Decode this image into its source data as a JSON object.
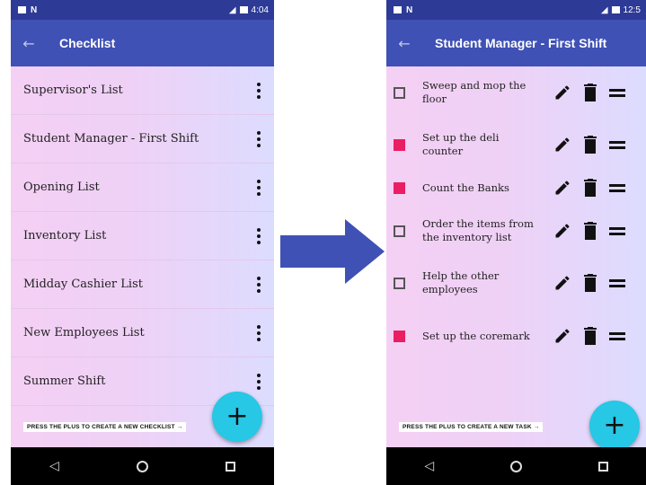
{
  "left_screen": {
    "status_time": "4:04",
    "title": "Checklist",
    "back_icon": "back-arrow-icon",
    "checklists": [
      {
        "label": "Supervisor's List"
      },
      {
        "label": "Student Manager - First Shift"
      },
      {
        "label": "Opening List"
      },
      {
        "label": "Inventory List"
      },
      {
        "label": "Midday Cashier List"
      },
      {
        "label": "New Employees List"
      },
      {
        "label": "Summer Shift"
      }
    ],
    "hint": "PRESS THE PLUS TO CREATE A NEW CHECKLIST →",
    "fab_label": "+"
  },
  "right_screen": {
    "status_time": "12:5",
    "title": "Student Manager - First Shift",
    "tasks": [
      {
        "text": "Sweep and mop the floor",
        "checked": false
      },
      {
        "text": "Set up the deli counter",
        "checked": true
      },
      {
        "text": "Count the Banks",
        "checked": true
      },
      {
        "text": "Order the items from the inventory list",
        "checked": false
      },
      {
        "text": "Help the other employees",
        "checked": false
      },
      {
        "text": "Set up the coremark",
        "checked": true
      }
    ],
    "hint": "PRESS THE PLUS TO CREATE A NEW TASK →",
    "fab_label": "+"
  },
  "nav": {
    "back": "◁"
  },
  "colors": {
    "status_bar": "#2d3a96",
    "app_bar": "#3f51b5",
    "fab": "#27c7e6",
    "checkbox_checked": "#e91e63",
    "arrow": "#3f51b5"
  }
}
